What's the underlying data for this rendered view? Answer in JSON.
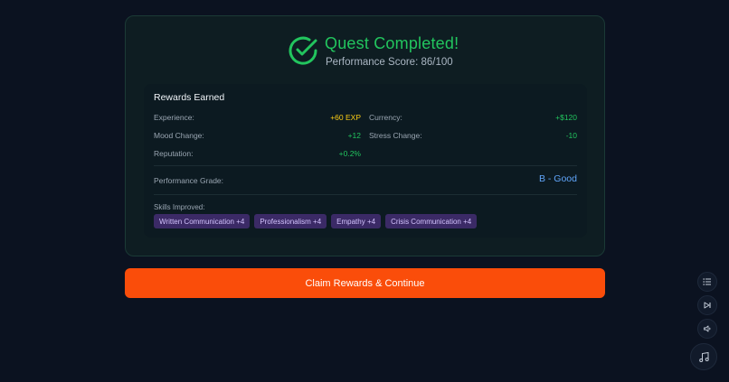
{
  "header": {
    "title": "Quest Completed!",
    "score": "Performance Score: 86/100",
    "accent": "#22c55e"
  },
  "rewards": {
    "title": "Rewards Earned",
    "experience_label": "Experience:",
    "experience_value": "+60 EXP",
    "currency_label": "Currency:",
    "currency_value": "+$120",
    "mood_label": "Mood Change:",
    "mood_value": "+12",
    "stress_label": "Stress Change:",
    "stress_value": "-10",
    "reputation_label": "Reputation:",
    "reputation_value": "+0.2%"
  },
  "grade": {
    "label": "Performance Grade:",
    "value": "B - Good"
  },
  "skills": {
    "label": "Skills Improved:",
    "items": [
      "Written Communication +4",
      "Professionalism +4",
      "Empathy +4",
      "Crisis Communication +4"
    ]
  },
  "cta": {
    "label": "Claim Rewards & Continue",
    "color": "#fa4d0a"
  },
  "controls": {
    "icons": [
      "list-icon",
      "skip-forward-icon",
      "volume-icon",
      "music-icon"
    ]
  }
}
